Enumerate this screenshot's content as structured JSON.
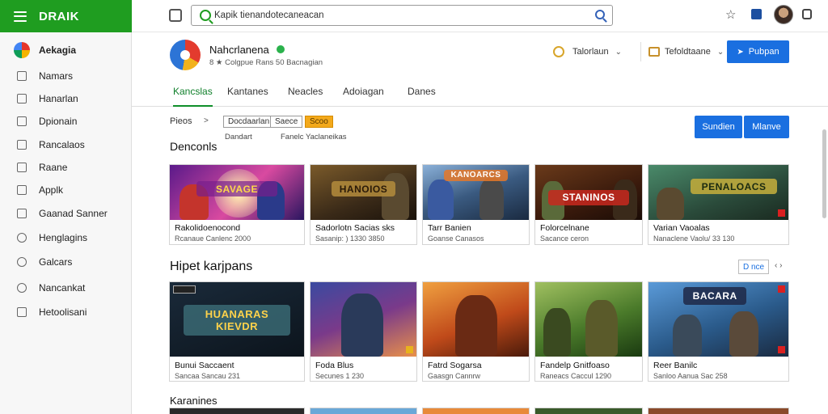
{
  "brand": {
    "name": "DRAIK"
  },
  "search": {
    "value": "Kapik tienandotecaneacan"
  },
  "sidebar": {
    "items": [
      {
        "label": "Aekagia",
        "icon": "app-logo-icon",
        "active": true
      },
      {
        "label": "Namars",
        "icon": "home-icon"
      },
      {
        "label": "Hanarlan",
        "icon": "grid-icon"
      },
      {
        "label": "Dpionain",
        "icon": "chart-icon"
      },
      {
        "label": "Rancalaos",
        "icon": "layers-icon"
      },
      {
        "label": "Raane",
        "icon": "flag-icon"
      },
      {
        "label": "Applk",
        "icon": "arrow-icon"
      },
      {
        "label": "Gaanad Sanner",
        "icon": "calendar-icon"
      },
      {
        "label": "Henglagins",
        "icon": "globe-icon"
      },
      {
        "label": "Galcars",
        "icon": "chat-icon"
      },
      {
        "label": "Nancankat",
        "icon": "clock-icon"
      },
      {
        "label": "Hetoolisani",
        "icon": "document-icon"
      }
    ]
  },
  "header": {
    "title": "Nahcrlanena",
    "subtitle": "8 ★ Colgpue Rans 50 Bacnagian",
    "button1": "Talorlaun",
    "button2": "Tefoldtaane",
    "publish": "Pubpan"
  },
  "tabs": [
    "Kancslas",
    "Kantanes",
    "Neacles",
    "Adoiagan",
    "Danes"
  ],
  "filters": {
    "label": "Pieos",
    "chips": [
      "Docdaarlan",
      "Saece",
      "Scoo"
    ],
    "notes": [
      "Dandart",
      "Fanelc Yaclaneikas"
    ],
    "btn1": "Sundien",
    "btn2": "Mlanve"
  },
  "sections": {
    "first": "Denconls",
    "second": "Hipet karjpans",
    "third": "Karanines",
    "view_all": "D nce",
    "view_arrows": "‹ ›"
  },
  "row1": [
    {
      "title": "Rakolidoenocond",
      "sub": "Rcanaue Canlenc 2000",
      "banner": "SAVAGE"
    },
    {
      "title": "Sadorlotn Sacias sks",
      "sub": "Sasanip: ) 1330 3850",
      "banner": "HANOIOS"
    },
    {
      "title": "Tarr Banien",
      "sub": "Goanse Canasos",
      "banner": "KANOARCS"
    },
    {
      "title": "Folorcelnane",
      "sub": "Sacance ceron",
      "banner": "STANINOS"
    },
    {
      "title": "Varian Vaoalas",
      "sub": "Nanaclene Vaolu/ 33 130",
      "banner": "PENALOACS"
    }
  ],
  "row2": [
    {
      "title": "Bunui Saccaent",
      "sub": "Sancaa Sancau 231",
      "banner": "HUANARAS KIEVDR"
    },
    {
      "title": "Foda Blus",
      "sub": "Secunes 1 230",
      "banner": ""
    },
    {
      "title": "Fatrd Sogarsa",
      "sub": "Gaasgn Cannrw",
      "banner": ""
    },
    {
      "title": "Fandelp Gnitfoaso",
      "sub": "Raneacs Caccul 1290",
      "banner": ""
    },
    {
      "title": "Reer Banilc",
      "sub": "Sanloo Aanua Sac 258",
      "banner": "BACARA"
    }
  ],
  "colors": {
    "brand_green": "#1f9d20",
    "accent_blue": "#1a6fe0",
    "chip_orange": "#f3a91b"
  }
}
